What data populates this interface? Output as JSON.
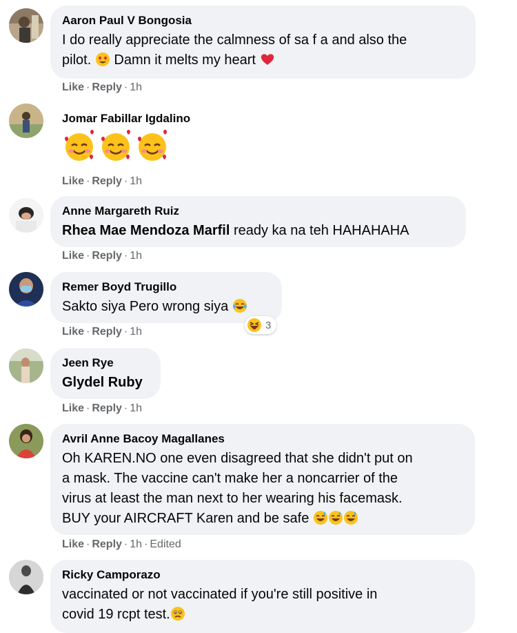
{
  "actions": {
    "like": "Like",
    "reply": "Reply",
    "dot": "·"
  },
  "comments": [
    {
      "author": "Aaron Paul V Bongosia",
      "line1": "I do really appreciate the calmness of sa f a and also the",
      "line2_a": "pilot.",
      "line2_b": "Damn it melts my heart",
      "time": "1h"
    },
    {
      "author": "Jomar Fabillar Igdalino",
      "time": "1h"
    },
    {
      "author": "Anne Margareth Ruiz",
      "mention": "Rhea Mae Mendoza Marfil",
      "text": " ready ka na teh HAHAHAHA",
      "time": "1h"
    },
    {
      "author": "Remer Boyd Trugillo",
      "text": "Sakto siya Pero wrong siya",
      "reaction_count": "3",
      "time": "1h"
    },
    {
      "author": "Jeen Rye",
      "mention": "Glydel Ruby",
      "time": "1h"
    },
    {
      "author": "Avril Anne Bacoy Magallanes",
      "lines": [
        "Oh KAREN.NO one even disagreed that she didn't put on",
        "a mask. The vaccine can't make her a noncarrier of the",
        "virus at least the man next to her wearing his facemask.",
        "BUY your AIRCRAFT Karen and be safe"
      ],
      "time": "1h",
      "edited": "Edited"
    },
    {
      "author": "Ricky Camporazo",
      "lines": [
        "vaccinated or not vaccinated if you're still positive in",
        "covid 19 rcpt test."
      ]
    }
  ]
}
